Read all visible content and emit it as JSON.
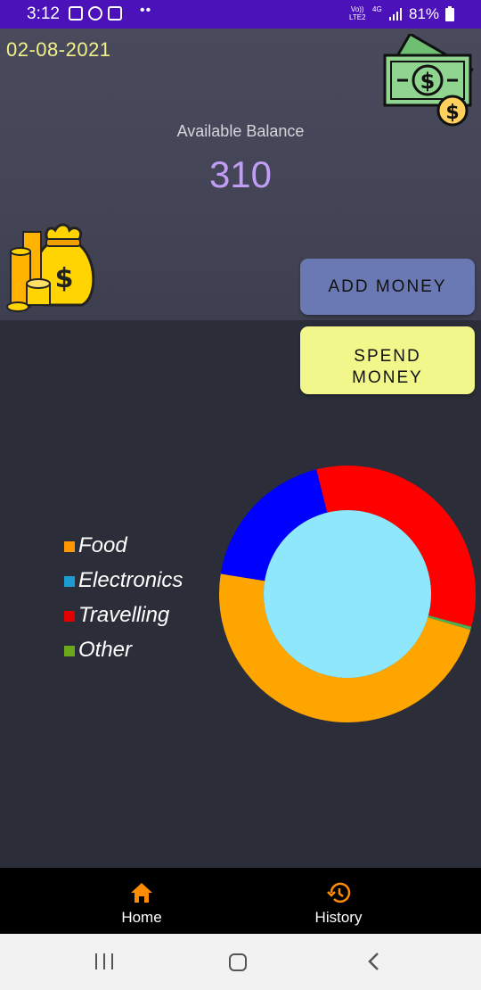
{
  "status_bar": {
    "time": "3:12",
    "network_top": "Vo))",
    "network_bottom": "LTE2",
    "network_type": "4G",
    "battery": "81%"
  },
  "header": {
    "date": "02-08-2021",
    "balance_label": "Available Balance",
    "balance_value": "310"
  },
  "actions": {
    "add_money": "ADD MONEY",
    "spend_money_line1": "SPEND",
    "spend_money_line2": "MONEY"
  },
  "legend": [
    {
      "label": "Food",
      "color": "#ff9800"
    },
    {
      "label": "Electronics",
      "color": "#1e9bd0"
    },
    {
      "label": "Travelling",
      "color": "#e00000"
    },
    {
      "label": "Other",
      "color": "#6aa81e"
    }
  ],
  "chart_data": {
    "type": "pie",
    "style": "donut",
    "slices": [
      {
        "label": "Travelling",
        "value": 33,
        "color": "#ff0000"
      },
      {
        "label": "Other",
        "value": 0.4,
        "color": "#4caf50"
      },
      {
        "label": "Food",
        "value": 48,
        "color": "#ffa500"
      },
      {
        "label": "Electronics",
        "value": 18.6,
        "color": "#0000ff"
      }
    ],
    "center_color": "#8ee7fb",
    "legend_position": "left"
  },
  "bottom_nav": {
    "home": "Home",
    "history": "History",
    "accent": "#ff8c00"
  }
}
